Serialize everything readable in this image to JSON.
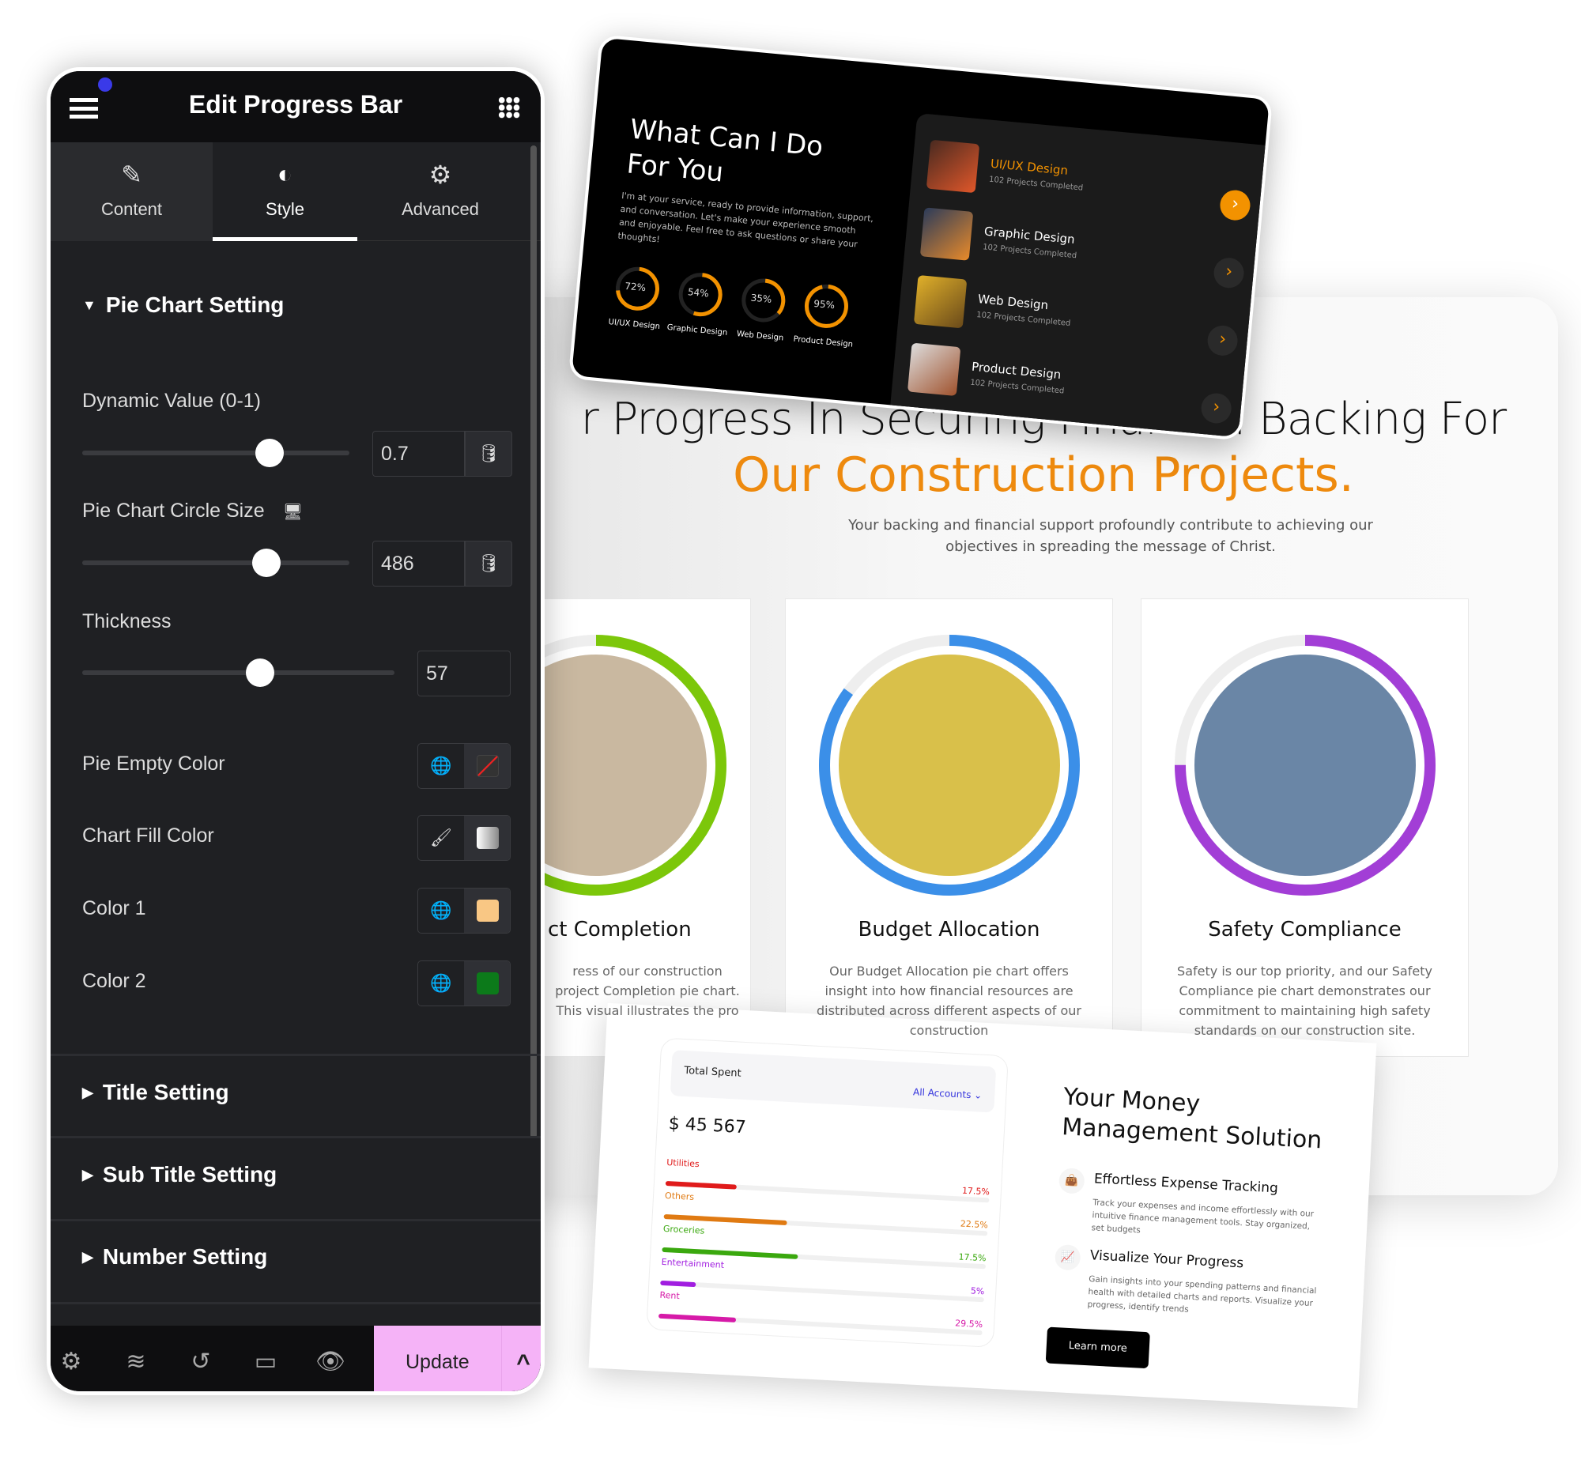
{
  "editor": {
    "title": "Edit Progress Bar",
    "tabs": [
      {
        "label": "Content",
        "icon": "pencil-icon"
      },
      {
        "label": "Style",
        "icon": "contrast-icon",
        "active": true
      },
      {
        "label": "Advanced",
        "icon": "gear-icon"
      }
    ],
    "section_open": "Pie Chart Setting",
    "dynamic_value": {
      "label": "Dynamic Value (0-1)",
      "value": "0.7",
      "slider_fraction": 0.7
    },
    "circle_size": {
      "label": "Pie Chart Circle Size",
      "value": "486",
      "slider_fraction": 0.69
    },
    "thickness": {
      "label": "Thickness",
      "value": "57",
      "slider_fraction": 0.57
    },
    "colors": [
      {
        "label": "Pie Empty Color",
        "icon": "globe-icon",
        "swatch": "none"
      },
      {
        "label": "Chart Fill Color",
        "icon": "brush-icon",
        "swatch": "gradient"
      },
      {
        "label": "Color 1",
        "icon": "globe-icon",
        "swatch": "#f9c784"
      },
      {
        "label": "Color 2",
        "icon": "globe-icon",
        "swatch": "#0c7a1a"
      }
    ],
    "sections_collapsed": [
      "Title Setting",
      "Sub Title Setting",
      "Number Setting"
    ],
    "bottom_icons": [
      "gear-icon",
      "layers-icon",
      "history-icon",
      "responsive-icon",
      "eye-icon"
    ],
    "update_label": "Update",
    "accent": "#f5b3f7"
  },
  "site": {
    "heading_line1": "r Progress In Securing Financial Backing For",
    "heading_line2": "Our Construction Projects.",
    "subtitle": "Your backing and financial support profoundly contribute to achieving our objectives in spreading the message of Christ.",
    "accent": "#ee8a0e",
    "cards": [
      {
        "title": "ct Completion",
        "text": "ress of our construction project Completion pie chart. This visual illustrates the pro",
        "ring_color": "#7cc70a",
        "ring_fraction": 0.62
      },
      {
        "title": "Budget Allocation",
        "text": "Our Budget Allocation pie chart offers insight into how financial resources are distributed across different aspects of our construction",
        "ring_color": "#3b8fe8",
        "ring_fraction": 0.85
      },
      {
        "title": "Safety Compliance",
        "text": "Safety is our top priority, and our Safety Compliance pie chart demonstrates our commitment to maintaining high safety standards on our construction site.",
        "ring_color": "#a23ed6",
        "ring_fraction": 0.75
      }
    ]
  },
  "services": {
    "title_line1": "What Can I Do",
    "title_line2": "For You",
    "text": "I'm at your service, ready to provide information, support, and conversation. Let's make your experience smooth and enjoyable. Feel free to ask questions or share your thoughts!",
    "rings": [
      {
        "value": 72,
        "label": "72%",
        "name": "UI/UX Design"
      },
      {
        "value": 54,
        "label": "54%",
        "name": "Graphic Design"
      },
      {
        "value": 35,
        "label": "35%",
        "name": "Web Design"
      },
      {
        "value": 95,
        "label": "95%",
        "name": "Product Design"
      }
    ],
    "items": [
      {
        "title": "UI/UX Design",
        "sub": "102 Projects Completed",
        "active": true
      },
      {
        "title": "Graphic Design",
        "sub": "102 Projects Completed"
      },
      {
        "title": "Web Design",
        "sub": "102 Projects Completed"
      },
      {
        "title": "Product Design",
        "sub": "102 Projects Completed"
      }
    ]
  },
  "money": {
    "total_label": "Total Spent",
    "account_select": "All Accounts",
    "amount": "$ 45 567",
    "bars": [
      {
        "name": "Utilities",
        "pct": "17.5%",
        "fill": 0.22,
        "color": "#e01b1b"
      },
      {
        "name": "Others",
        "pct": "22.5%",
        "fill": 0.38,
        "color": "#e07a12"
      },
      {
        "name": "Groceries",
        "pct": "17.5%",
        "fill": 0.42,
        "color": "#3aa80e"
      },
      {
        "name": "Entertainment",
        "pct": "5%",
        "fill": 0.11,
        "color": "#a11ee0"
      },
      {
        "name": "Rent",
        "pct": "29.5%",
        "fill": 0.24,
        "color": "#d61aa8"
      }
    ],
    "title_line1": "Your Money",
    "title_line2": "Management Solution",
    "features": [
      {
        "icon": "wallet-icon",
        "title": "Effortless Expense Tracking",
        "text": "Track your expenses and income effortlessly with our intuitive finance management tools. Stay organized, set budgets"
      },
      {
        "icon": "chart-line-icon",
        "title": "Visualize Your Progress",
        "text": "Gain insights into your spending patterns and financial health with detailed charts and reports. Visualize your progress, identify trends"
      }
    ],
    "button": "Learn more"
  }
}
